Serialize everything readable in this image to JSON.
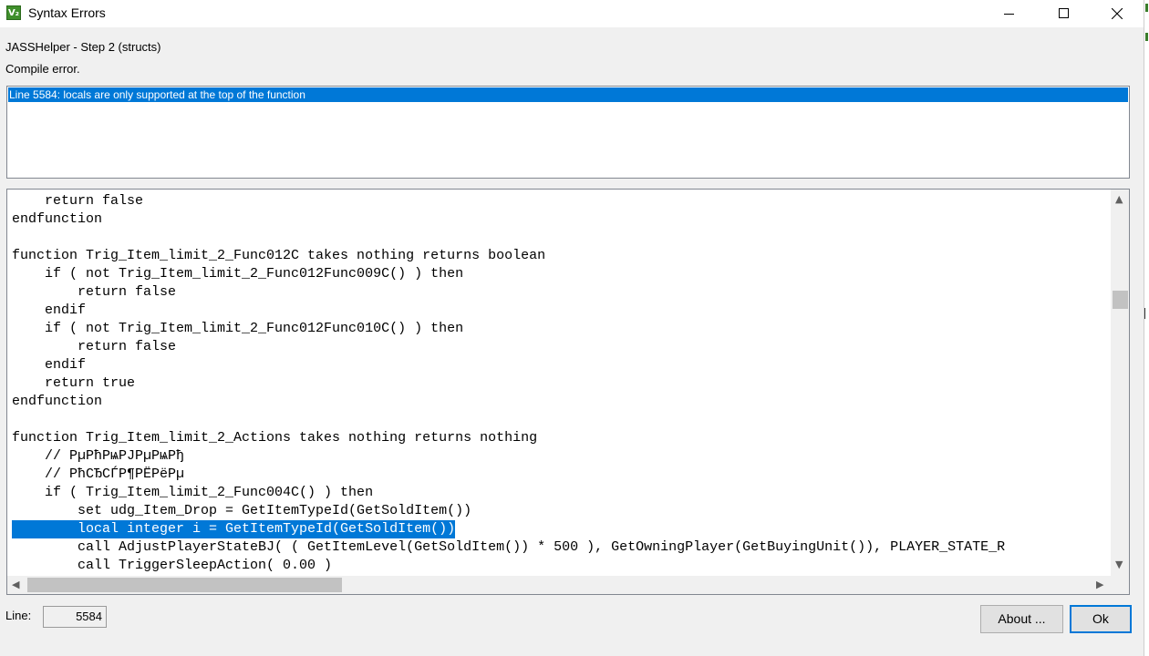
{
  "window": {
    "title": "Syntax Errors",
    "icon_text": "V₂",
    "controls": {
      "minimize": "minimize-icon",
      "maximize": "maximize-icon",
      "close": "close-icon"
    }
  },
  "header": {
    "step_label": "JASSHelper - Step 2 (structs)",
    "status_label": "Compile error."
  },
  "errors": [
    {
      "text": "Line 5584: locals are only supported at the top of the function",
      "selected": true
    }
  ],
  "code": {
    "lines": [
      {
        "text": "    return false"
      },
      {
        "text": "endfunction"
      },
      {
        "text": ""
      },
      {
        "text": "function Trig_Item_limit_2_Func012C takes nothing returns boolean"
      },
      {
        "text": "    if ( not Trig_Item_limit_2_Func012Func009C() ) then"
      },
      {
        "text": "        return false"
      },
      {
        "text": "    endif"
      },
      {
        "text": "    if ( not Trig_Item_limit_2_Func012Func010C() ) then"
      },
      {
        "text": "        return false"
      },
      {
        "text": "    endif"
      },
      {
        "text": "    return true"
      },
      {
        "text": "endfunction"
      },
      {
        "text": ""
      },
      {
        "text": "function Trig_Item_limit_2_Actions takes nothing returns nothing"
      },
      {
        "text": "    // РµРћРѩРЈРµРѩРђ"
      },
      {
        "text": "    // РћСЂСЃР¶РЁРёРµ"
      },
      {
        "text": "    if ( Trig_Item_limit_2_Func004C() ) then"
      },
      {
        "text": "        set udg_Item_Drop = GetItemTypeId(GetSoldItem())"
      },
      {
        "text": "        local integer i = GetItemTypeId(GetSoldItem())",
        "selected": true
      },
      {
        "text": "        call AdjustPlayerStateBJ( ( GetItemLevel(GetSoldItem()) * 500 ), GetOwningPlayer(GetBuyingUnit()), PLAYER_STATE_R"
      },
      {
        "text": "        call TriggerSleepAction( 0.00 )"
      }
    ]
  },
  "scroll": {
    "up": "▲",
    "down": "▼",
    "left": "◀",
    "right": "▶"
  },
  "footer": {
    "line_label": "Line:",
    "line_value": "5584",
    "about_button": "About ...",
    "ok_button": "Ok"
  }
}
